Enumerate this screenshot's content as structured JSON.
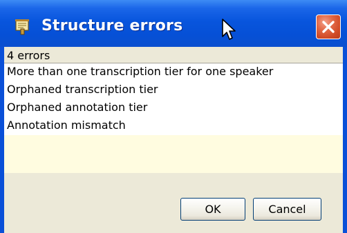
{
  "window": {
    "title": "Structure errors",
    "icon": "notepad-tool-icon",
    "close_icon": "close-x-icon"
  },
  "summary": {
    "error_count_text": "4 errors"
  },
  "errors": [
    "More than one transcription tier for one speaker",
    "Orphaned transcription tier",
    "Orphaned annotation tier",
    "Annotation mismatch"
  ],
  "buttons": {
    "ok_label": "OK",
    "cancel_label": "Cancel"
  },
  "colors": {
    "titlebar": "#0855dd",
    "close_button": "#d04a26",
    "dialog_face": "#ece9d8",
    "list_empty_area": "#fffce0"
  }
}
